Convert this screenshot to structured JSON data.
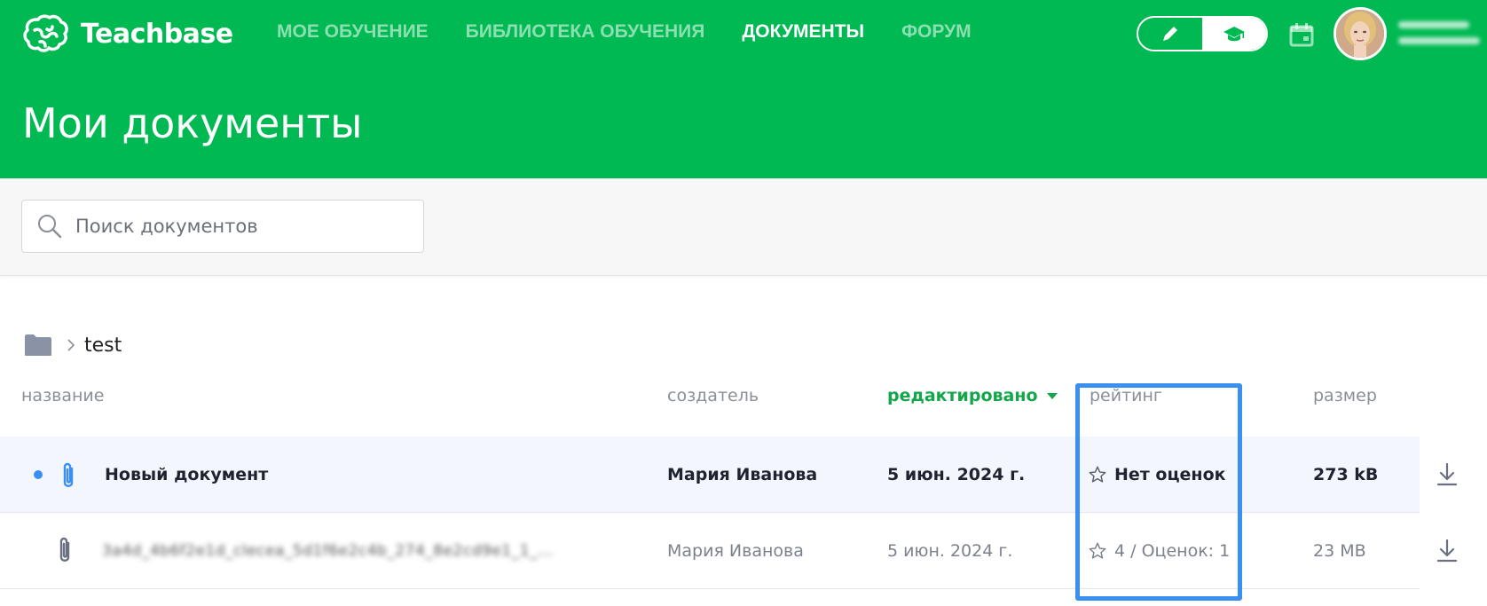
{
  "app": {
    "logo_text": "Teachbase"
  },
  "nav": {
    "items": [
      {
        "label": "МОЕ ОБУЧЕНИЕ",
        "active": false
      },
      {
        "label": "БИБЛИОТЕКА ОБУЧЕНИЯ",
        "active": false
      },
      {
        "label": "ДОКУМЕНТЫ",
        "active": true
      },
      {
        "label": "ФОРУМ",
        "active": false
      }
    ]
  },
  "header": {
    "page_title": "Мои документы"
  },
  "search": {
    "placeholder": "Поиск документов",
    "value": ""
  },
  "breadcrumb": {
    "current": "test"
  },
  "table": {
    "columns": {
      "name": "название",
      "creator": "создатель",
      "edited": "редактировано",
      "rating": "рейтинг",
      "size": "размер"
    },
    "rows": [
      {
        "name": "Новый документ",
        "creator": "Мария Иванова",
        "edited": "5 июн. 2024 г.",
        "rating": "Нет оценок",
        "size": "273 kB",
        "unread": true
      },
      {
        "name": "3a4d_4b6f2e1d_clecea_5d1f6e2c4b_274_8e2cd9e1_1_...",
        "creator": "Мария Иванова",
        "edited": "5 июн. 2024 г.",
        "rating": "4 / Оценок: 1",
        "size": "23 MB",
        "unread": false
      }
    ]
  },
  "colors": {
    "brand_green": "#00b952",
    "sort_green": "#14a64a",
    "accent_blue": "#3b8ff0"
  },
  "icons": [
    "brain-logo-icon",
    "pencil-icon",
    "graduation-cap-icon",
    "calendar-icon",
    "search-icon",
    "folder-icon",
    "chevron-right-icon",
    "paperclip-icon",
    "star-icon",
    "download-icon",
    "sort-caret-icon"
  ]
}
